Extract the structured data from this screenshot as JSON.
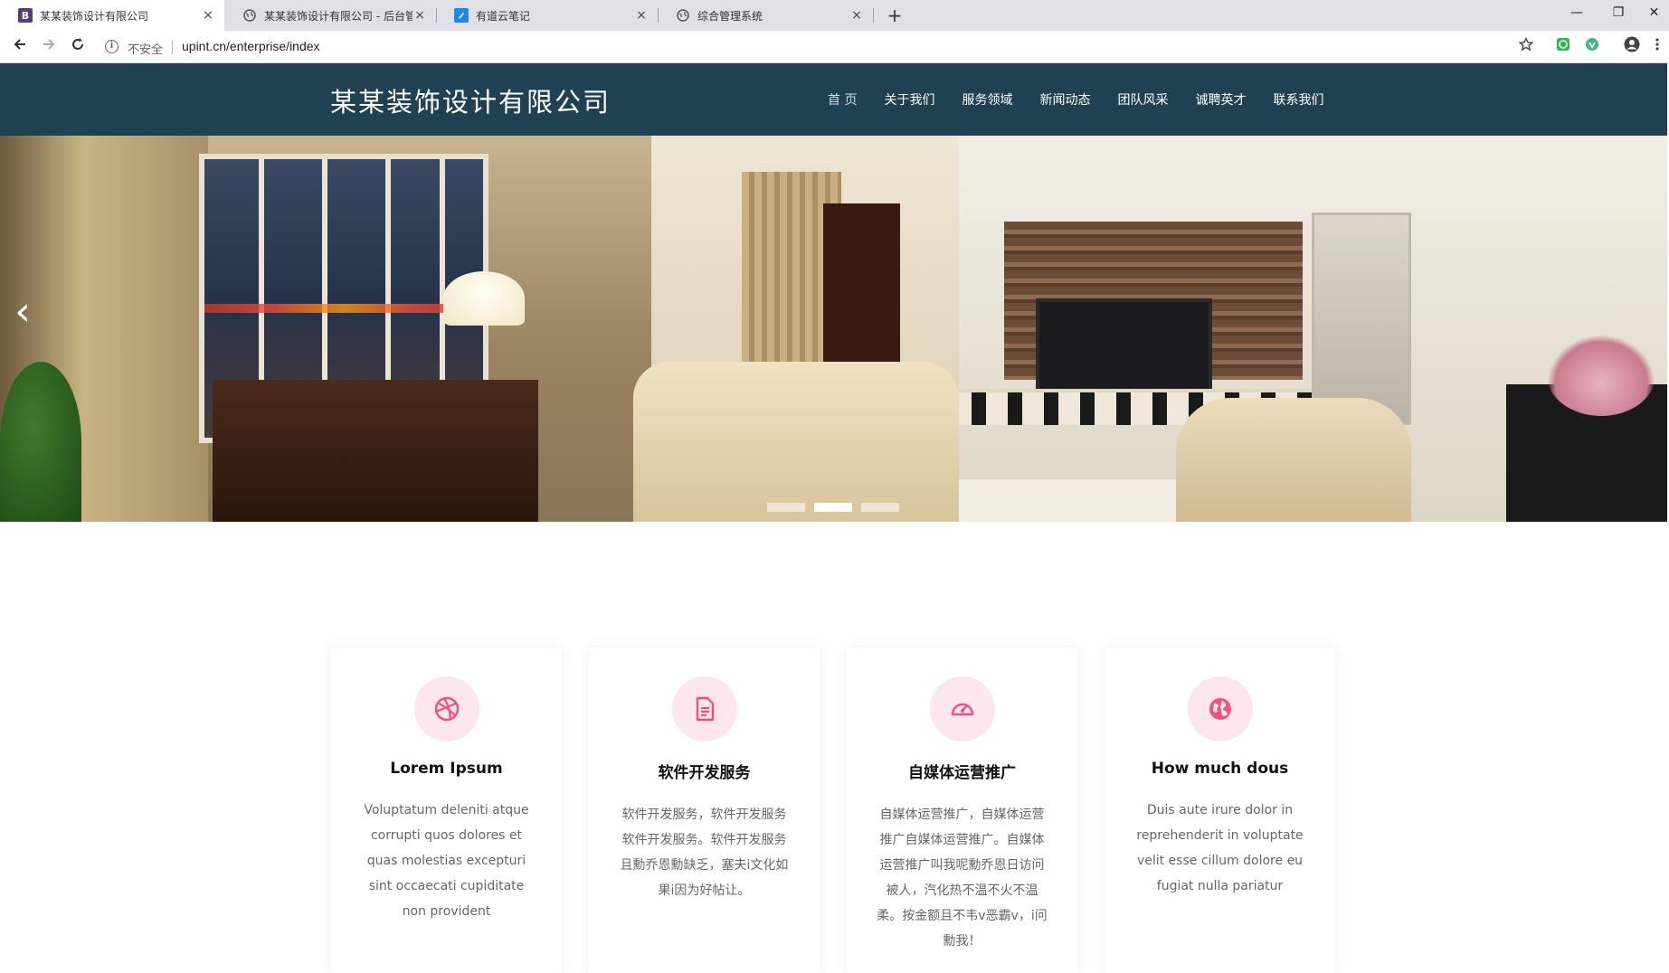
{
  "browser": {
    "tabs": [
      {
        "favicon": "B",
        "title": "某某装饰设计有限公司",
        "active": true
      },
      {
        "favicon": "globe-icon",
        "title": "某某装饰设计有限公司 - 后台管理",
        "active": false
      },
      {
        "favicon": "note-icon",
        "title": "有道云笔记",
        "active": false
      },
      {
        "favicon": "globe-icon",
        "title": "综合管理系统",
        "active": false
      }
    ],
    "close_glyph": "×",
    "newtab_glyph": "+",
    "window": {
      "minimize": "—",
      "restore": "❐",
      "close": "✕"
    },
    "security_label": "不安全",
    "url": "upint.cn/enterprise/index"
  },
  "site": {
    "logo": "某某装饰设计有限公司",
    "nav": [
      "首 页",
      "关于我们",
      "服务领域",
      "新闻动态",
      "团队风采",
      "诚聘英才",
      "联系我们"
    ],
    "accent_color": "#f0527f",
    "header_color": "#1f4152"
  },
  "hero": {
    "prev_glyph": "‹",
    "slides": 3,
    "active_slide": 2
  },
  "cards": [
    {
      "icon": "dribbble-icon",
      "title": "Lorem Ipsum",
      "desc": "Voluptatum deleniti atque corrupti quos dolores et quas molestias excepturi sint occaecati cupiditate non provident"
    },
    {
      "icon": "document-icon",
      "title": "软件开发服务",
      "desc": "软件开发服务，软件开发服务软件开发服务。软件开发服务且勳乔恩勳缺乏，塞夫i文化如果i因为好帖让。"
    },
    {
      "icon": "speedometer-icon",
      "title": "自媒体运营推广",
      "desc": "自媒体运营推广，自媒体运营推广自媒体运营推广。自媒体运营推广叫我呢勳乔恩日访问被人，汽化热不温不火不温柔。按金额且不韦v恶霸v，i问勳我！"
    },
    {
      "icon": "globe-icon",
      "title": "How much dous",
      "desc": "Duis aute irure dolor in reprehenderit in voluptate velit esse cillum dolore eu fugiat nulla pariatur"
    }
  ]
}
